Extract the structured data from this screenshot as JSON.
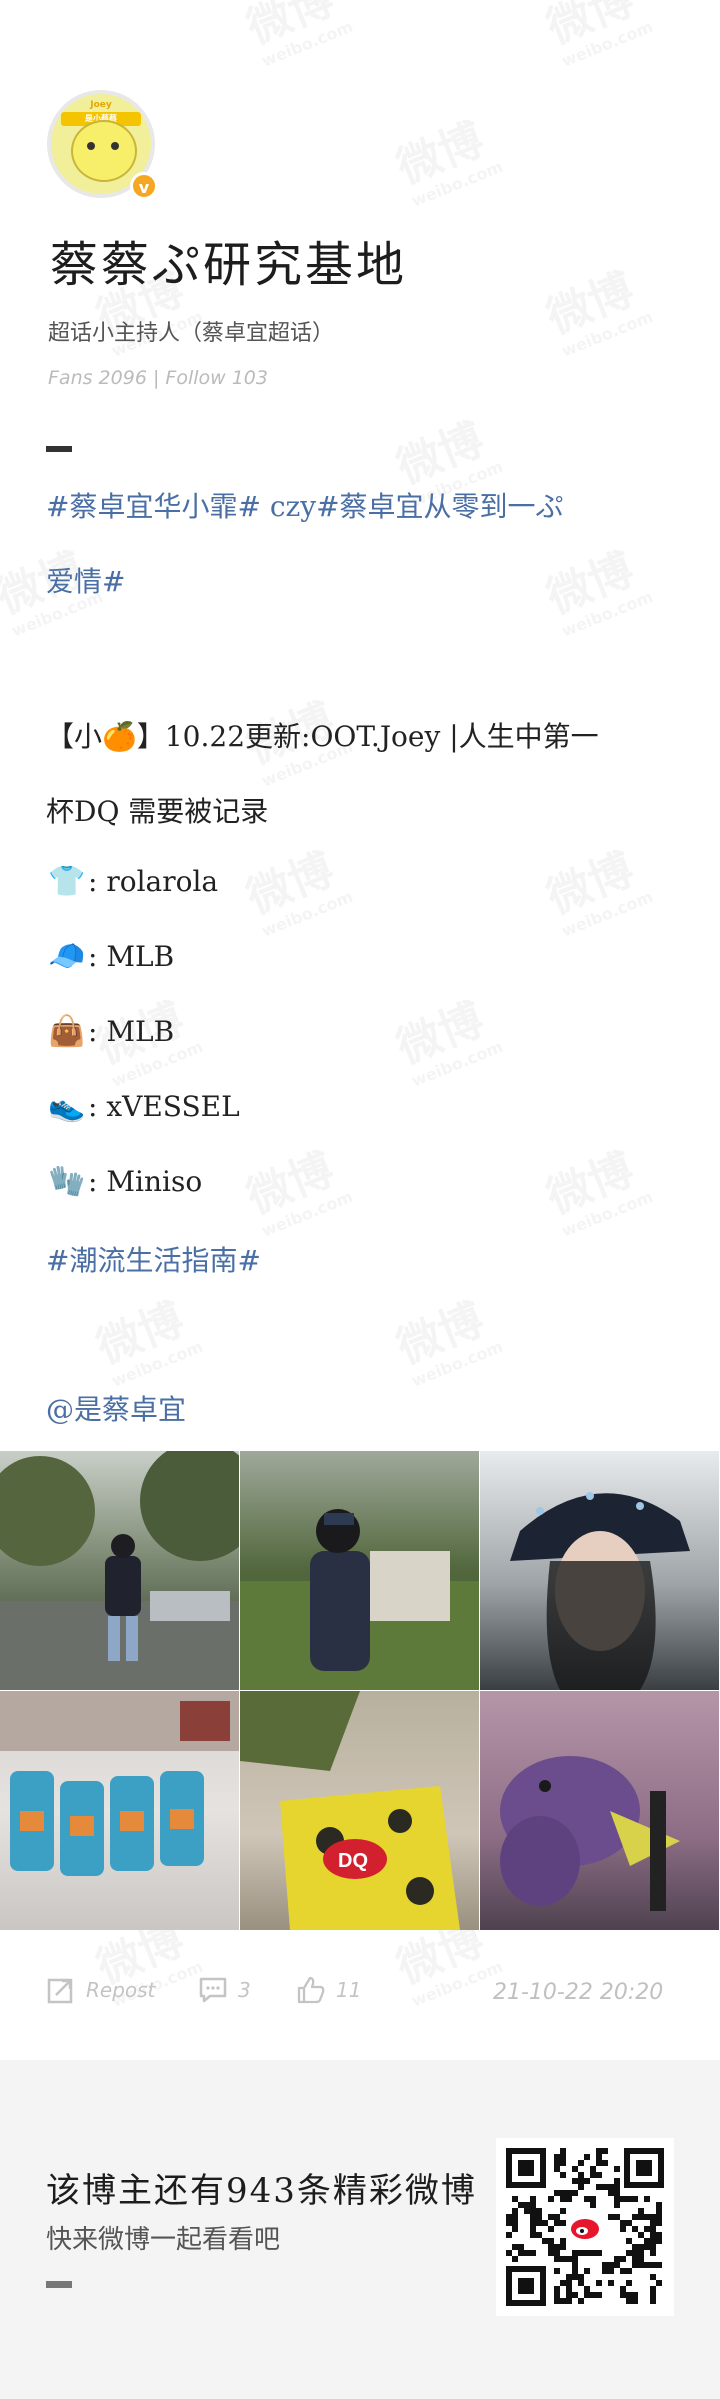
{
  "profile": {
    "avatar_text_top": "Joey",
    "avatar_text_banner": "是小蔡蔡",
    "verified_icon": "verified-badge-icon",
    "title": "蔡蔡ぷ研究基地",
    "subtitle": "超话小主持人（蔡卓宜超话）",
    "stats": "Fans 2096 | Follow 103"
  },
  "post": {
    "hashtags_line1": "#蔡卓宜华小霏# czy#蔡卓宜从零到一ぷ",
    "hashtags_line2": "爱情#",
    "headline_line1": "【小🍊】10.22更新:OOT.Joey |人生中第一",
    "headline_line2": "杯DQ 需要被记录",
    "items": [
      {
        "icon": "👕",
        "icon_name": "tshirt-icon",
        "text": "rolarola"
      },
      {
        "icon": "🧢",
        "icon_name": "cap-icon",
        "text": "MLB"
      },
      {
        "icon": "👜",
        "icon_name": "handbag-icon",
        "text": "MLB"
      },
      {
        "icon": "👟",
        "icon_name": "sneaker-icon",
        "text": "xVESSEL"
      },
      {
        "icon": "🧤",
        "icon_name": "gloves-icon",
        "text": "Miniso"
      }
    ],
    "tag2": "#潮流生活指南#",
    "mention": "@是蔡卓宜"
  },
  "photos": [
    {
      "name": "photo-standing-in-park"
    },
    {
      "name": "photo-sitting-by-bushes"
    },
    {
      "name": "photo-bucket-hat-selfie"
    },
    {
      "name": "photo-cups-on-table"
    },
    {
      "name": "photo-dq-bag"
    },
    {
      "name": "photo-purple-dinosaur-toy"
    }
  ],
  "actions": {
    "repost_label": "Repost",
    "comment_count": "3",
    "like_count": "11",
    "timestamp": "21-10-22 20:20"
  },
  "footer": {
    "title": "该博主还有943条精彩微博",
    "subtitle": "快来微博一起看看吧"
  },
  "watermark": {
    "text": "微博",
    "sub": "weibo.com"
  },
  "colors": {
    "hashtag": "#4a6fa5",
    "verified": "#f5a623",
    "background": "#f4f4f4"
  }
}
